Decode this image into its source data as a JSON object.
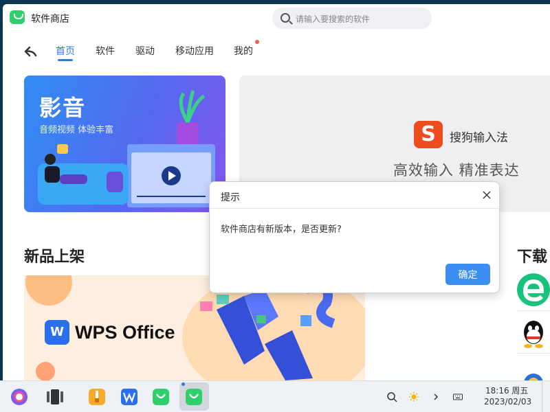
{
  "app": {
    "title": "软件商店"
  },
  "search": {
    "placeholder": "请输入要搜索的软件"
  },
  "nav": {
    "tabs": [
      {
        "label": "首页",
        "active": true
      },
      {
        "label": "软件",
        "active": false
      },
      {
        "label": "驱动",
        "active": false
      },
      {
        "label": "移动应用",
        "active": false
      },
      {
        "label": "我的",
        "active": false,
        "badge": true
      }
    ]
  },
  "banners": {
    "media": {
      "title": "影音",
      "subtitle": "音频视频 体验丰富"
    },
    "ime": {
      "logo_letter": "S",
      "name": "搜狗输入法",
      "slogan": "高效输入 精准表达"
    }
  },
  "sections": {
    "new": {
      "title": "新品上架"
    },
    "downloads": {
      "title": "下载"
    }
  },
  "featured": {
    "logo_letter": "W",
    "name": "WPS Office"
  },
  "dialog": {
    "title": "提示",
    "message": "软件商店有新版本，是否更新?",
    "ok_label": "确定"
  },
  "taskbar": {
    "clock_time": "18:16 周五",
    "clock_date": "2023/02/03"
  },
  "colors": {
    "accent": "#2c7be5",
    "button": "#3d8ef2",
    "app_green": "#2fcf6c",
    "sogou_red": "#ee4d1f",
    "wps_blue": "#2a6ff0"
  }
}
